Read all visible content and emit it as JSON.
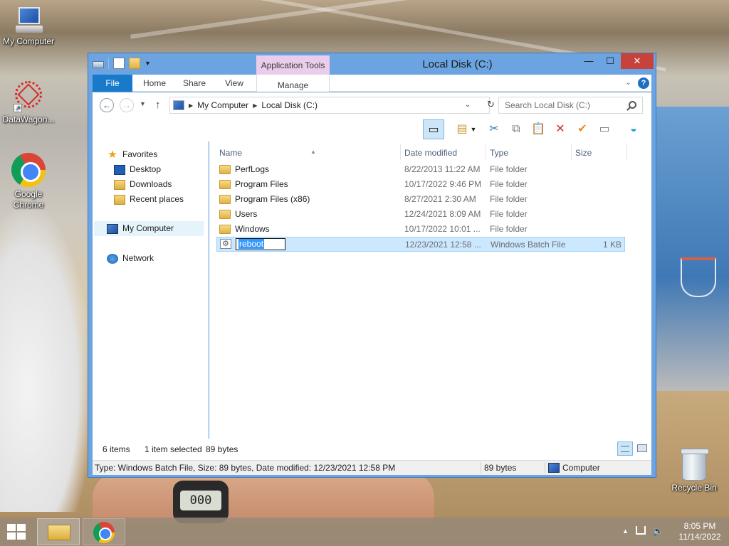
{
  "desktop": {
    "icons": [
      {
        "label": "My Computer"
      },
      {
        "label": "DataWagon..."
      },
      {
        "label": "Google Chrome"
      },
      {
        "label": "Recycle Bin"
      }
    ],
    "wallpaper_watch_text": "000"
  },
  "window": {
    "title": "Local Disk (C:)",
    "context_tab_group": "Application Tools",
    "buttons": {
      "minimize": "—",
      "maximize": "☐",
      "close": "✕"
    },
    "ribbon_tabs": [
      "File",
      "Home",
      "Share",
      "View",
      "Manage"
    ],
    "help_label": "?",
    "address": {
      "crumbs": [
        "My Computer",
        "Local Disk (C:)"
      ]
    },
    "search": {
      "placeholder": "Search Local Disk (C:)"
    },
    "nav_pane": {
      "favorites_label": "Favorites",
      "favorites": [
        "Desktop",
        "Downloads",
        "Recent places"
      ],
      "computer_label": "My Computer",
      "network_label": "Network"
    },
    "columns": [
      "Name",
      "Date modified",
      "Type",
      "Size"
    ],
    "files": [
      {
        "name": "PerfLogs",
        "date": "8/22/2013 11:22 AM",
        "type": "File folder",
        "size": "",
        "icon": "folder-icon"
      },
      {
        "name": "Program Files",
        "date": "10/17/2022 9:46 PM",
        "type": "File folder",
        "size": "",
        "icon": "folder-icon"
      },
      {
        "name": "Program Files (x86)",
        "date": "8/27/2021 2:30 AM",
        "type": "File folder",
        "size": "",
        "icon": "folder-icon"
      },
      {
        "name": "Users",
        "date": "12/24/2021 8:09 AM",
        "type": "File folder",
        "size": "",
        "icon": "folder-icon"
      },
      {
        "name": "Windows",
        "date": "10/17/2022 10:01 ...",
        "type": "File folder",
        "size": "",
        "icon": "folder-icon"
      },
      {
        "name": "reboot",
        "date": "12/23/2021 12:58 ...",
        "type": "Windows Batch File",
        "size": "1 KB",
        "icon": "batch-file-icon",
        "selected": true,
        "renaming": true
      }
    ],
    "status": {
      "item_count": "6 items",
      "selection": "1 item selected",
      "selection_size": "89 bytes"
    },
    "details_bar": {
      "description": "Type: Windows Batch File, Size: 89 bytes, Date modified: 12/23/2021 12:58 PM",
      "size": "89 bytes",
      "location": "Computer"
    }
  },
  "taskbar": {
    "time": "8:05 PM",
    "date": "11/14/2022",
    "tray_chevron": "▲"
  },
  "colors": {
    "title_bar": "#6ba4e0",
    "file_tab": "#1979ca",
    "close_button": "#c6423a",
    "app_tools": "#e9cdeb",
    "selection": "#cce8ff"
  }
}
